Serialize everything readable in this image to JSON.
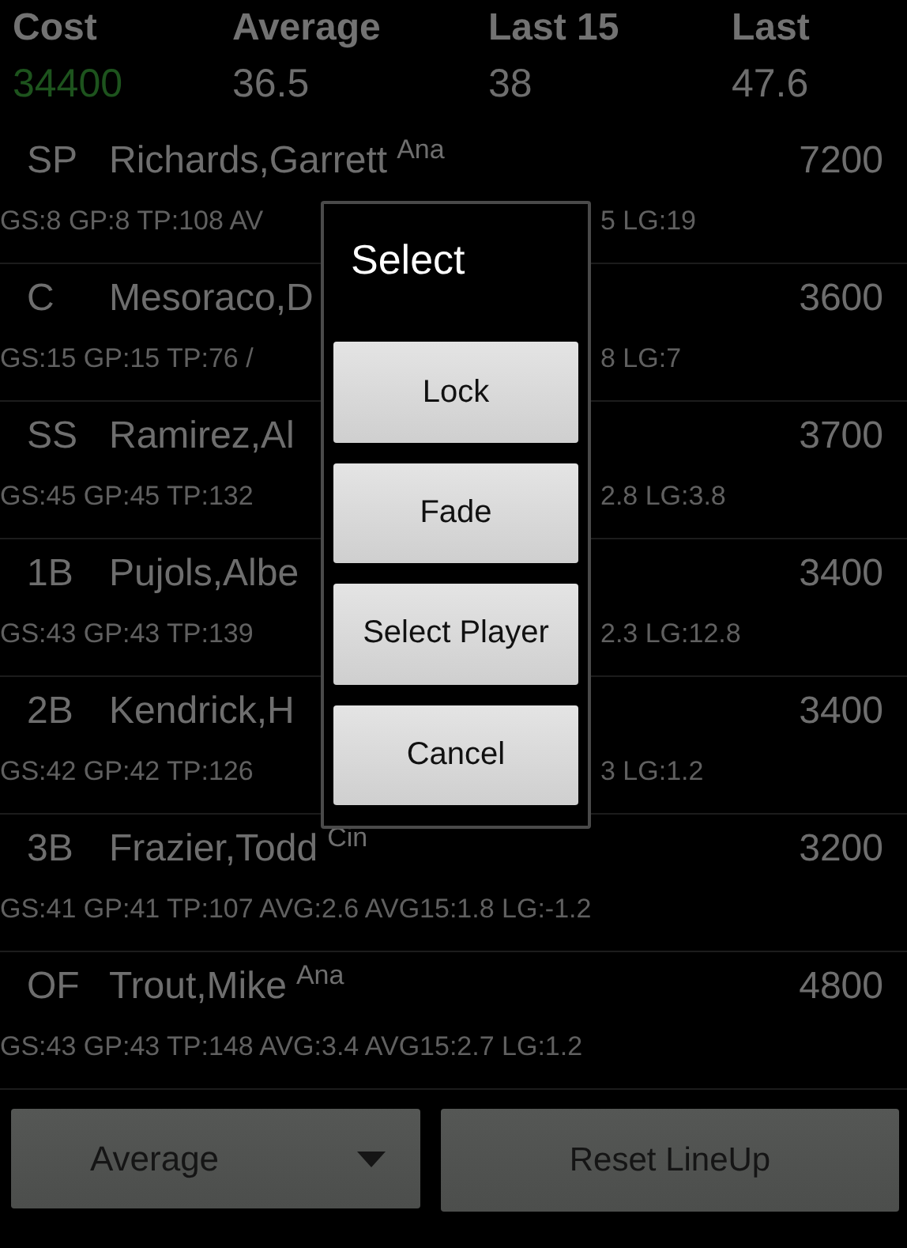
{
  "summary": [
    {
      "label": "Cost",
      "value": "34400",
      "color": "#1d531d"
    },
    {
      "label": "Average",
      "value": "36.5",
      "color": "#6e6e6e"
    },
    {
      "label": "Last 15",
      "value": "38",
      "color": "#6e6e6e"
    },
    {
      "label": "Last",
      "value": "47.6",
      "color": "#6e6e6e"
    }
  ],
  "players": [
    {
      "position": "SP",
      "name": "Richards,Garrett",
      "team": "Ana",
      "cost": "7200",
      "stats": "GS:8 GP:8 TP:108 AV",
      "stats_right": "5 LG:19"
    },
    {
      "position": "C",
      "name": "Mesoraco,D",
      "cost": "3600",
      "stats": "GS:15 GP:15 TP:76 /",
      "stats_right": "8 LG:7"
    },
    {
      "position": "SS",
      "name": "Ramirez,Al",
      "cost": "3700",
      "stats": "GS:45 GP:45 TP:132",
      "stats_right": "2.8 LG:3.8"
    },
    {
      "position": "1B",
      "name": "Pujols,Albe",
      "cost": "3400",
      "stats": "GS:43 GP:43 TP:139",
      "stats_right": "2.3 LG:12.8"
    },
    {
      "position": "2B",
      "name": "Kendrick,H",
      "cost": "3400",
      "stats": "GS:42 GP:42 TP:126",
      "stats_right": "3 LG:1.2"
    },
    {
      "position": "3B",
      "name": "Frazier,Todd",
      "team": "Cin",
      "cost": "3200",
      "stats": "GS:41 GP:41 TP:107 AVG:2.6 AVG15:1.8 LG:-1.2"
    },
    {
      "position": "OF",
      "name": "Trout,Mike",
      "team": "Ana",
      "cost": "4800",
      "stats": "GS:43 GP:43 TP:148 AVG:3.4 AVG15:2.7 LG:1.2"
    }
  ],
  "sort_dropdown": {
    "value": "Average"
  },
  "reset_button": {
    "label": "Reset LineUp"
  },
  "dialog": {
    "title": "Select",
    "buttons": [
      "Lock",
      "Fade",
      "Select Player",
      "Cancel"
    ]
  }
}
